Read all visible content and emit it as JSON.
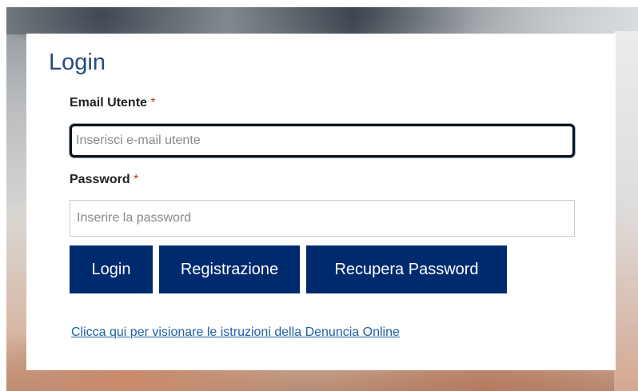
{
  "login": {
    "title": "Login",
    "email_label": "Email Utente",
    "required_mark": "*",
    "email_placeholder": "Inserisci e-mail utente",
    "email_value": "",
    "password_label": "Password",
    "password_placeholder": "Inserire la password",
    "password_value": "",
    "buttons": {
      "login": "Login",
      "register": "Registrazione",
      "recover": "Recupera Password"
    },
    "instructions_link": "Clicca qui per visionare le istruzioni della Denuncia Online"
  },
  "colors": {
    "title": "#254a7e",
    "button_bg": "#002a6e",
    "button_text": "#ffffff",
    "required": "#c0392b",
    "link": "#1f5fa8"
  }
}
